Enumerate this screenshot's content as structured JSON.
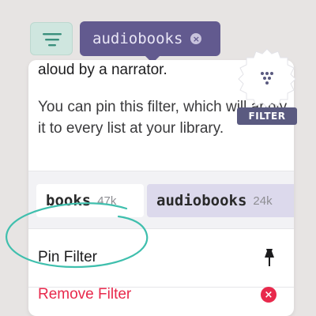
{
  "toolbar": {
    "active_filter": "audiobooks"
  },
  "popover": {
    "description_top": "aloud by a narrator.",
    "description_body": "You can pin this filter, which will apply it to every list at your library.",
    "filters": [
      {
        "name": "books",
        "count": "47k"
      },
      {
        "name": "audiobooks",
        "count": "24k"
      }
    ],
    "pin_label": "Pin Filter",
    "remove_label": "Remove Filter"
  },
  "badge": {
    "label": "FILTER"
  },
  "colors": {
    "active_chip": "#625a8f",
    "menu_button": "#cfe6df",
    "highlight_ring": "#3fbfad",
    "destructive": "#e8294c"
  }
}
